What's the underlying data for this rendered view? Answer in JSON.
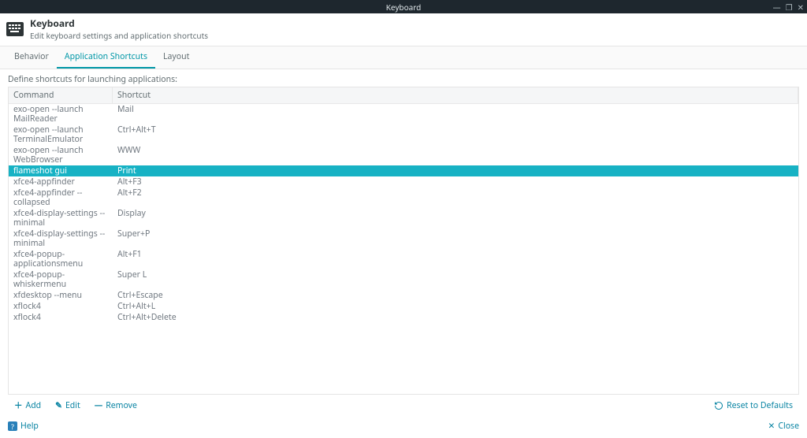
{
  "window": {
    "title": "Keyboard"
  },
  "header": {
    "title": "Keyboard",
    "subtitle": "Edit keyboard settings and application shortcuts"
  },
  "tabs": {
    "behavior": "Behavior",
    "app_shortcuts": "Application Shortcuts",
    "layout": "Layout"
  },
  "main": {
    "description": "Define shortcuts for launching applications:",
    "columns": {
      "command": "Command",
      "shortcut": "Shortcut"
    },
    "rows": [
      {
        "command": "exo-open --launch MailReader",
        "shortcut": "Mail",
        "selected": false
      },
      {
        "command": "exo-open --launch TerminalEmulator",
        "shortcut": "Ctrl+Alt+T",
        "selected": false
      },
      {
        "command": "exo-open --launch WebBrowser",
        "shortcut": "WWW",
        "selected": false
      },
      {
        "command": "flameshot gui",
        "shortcut": "Print",
        "selected": true
      },
      {
        "command": "xfce4-appfinder",
        "shortcut": "Alt+F3",
        "selected": false
      },
      {
        "command": "xfce4-appfinder --collapsed",
        "shortcut": "Alt+F2",
        "selected": false
      },
      {
        "command": "xfce4-display-settings --minimal",
        "shortcut": "Display",
        "selected": false
      },
      {
        "command": "xfce4-display-settings --minimal",
        "shortcut": "Super+P",
        "selected": false
      },
      {
        "command": "xfce4-popup-applicationsmenu",
        "shortcut": "Alt+F1",
        "selected": false
      },
      {
        "command": "xfce4-popup-whiskermenu",
        "shortcut": "Super L",
        "selected": false
      },
      {
        "command": "xfdesktop --menu",
        "shortcut": "Ctrl+Escape",
        "selected": false
      },
      {
        "command": "xflock4",
        "shortcut": "Ctrl+Alt+L",
        "selected": false
      },
      {
        "command": "xflock4",
        "shortcut": "Ctrl+Alt+Delete",
        "selected": false
      }
    ]
  },
  "toolbar": {
    "add": "Add",
    "edit": "Edit",
    "remove": "Remove",
    "reset": "Reset to Defaults"
  },
  "footer": {
    "help": "Help",
    "close": "Close"
  }
}
